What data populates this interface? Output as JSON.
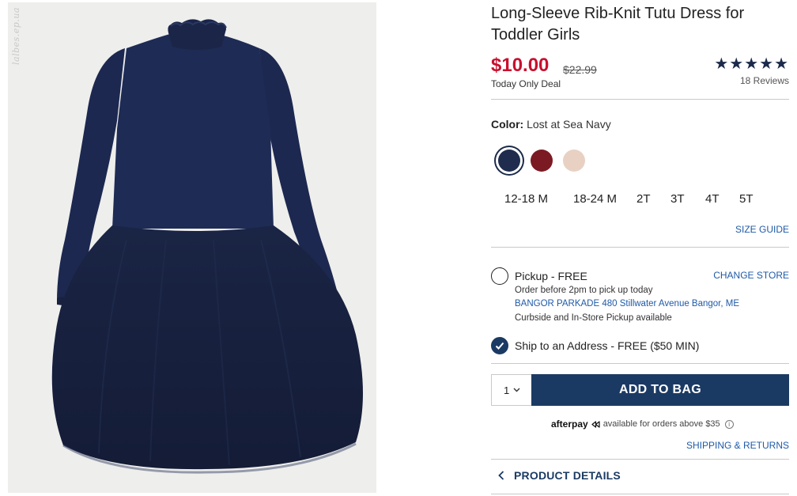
{
  "photo": {
    "watermark": "lalbes.ep.ua",
    "bg_color": "#eeeeec",
    "dress_color": "#1b2649"
  },
  "product": {
    "title": "Long-Sleeve Rib-Knit Tutu Dress for Toddler Girls",
    "price": "$10.00",
    "original_price": "$22.99",
    "deal_label": "Today Only Deal",
    "rating_stars": "★★★★★",
    "rating_value": 5,
    "reviews": "18 Reviews"
  },
  "color": {
    "label": "Color:",
    "selected_name": "Lost at Sea Navy",
    "swatches": [
      {
        "name": "navy-swatch",
        "hex": "#1f2c4d",
        "selected": true
      },
      {
        "name": "burgundy-swatch",
        "hex": "#7b1a23",
        "selected": false
      },
      {
        "name": "blush-swatch",
        "hex": "#e8d1c3",
        "selected": false
      }
    ]
  },
  "sizes": [
    "12-18 M",
    "18-24 M",
    "2T",
    "3T",
    "4T",
    "5T"
  ],
  "size_guide": "SIZE GUIDE",
  "fulfillment": {
    "pickup_label": "Pickup - FREE",
    "pickup_selected": false,
    "change_store": "CHANGE STORE",
    "order_before": "Order before 2pm to pick up today",
    "store": "BANGOR PARKADE 480 Stillwater Avenue  Bangor, ME",
    "curbside": "Curbside and In-Store Pickup available",
    "ship_label": "Ship to an Address - FREE ($50 MIN)",
    "ship_selected": true
  },
  "cart": {
    "qty": "1",
    "add_to_bag": "ADD TO BAG"
  },
  "afterpay": {
    "logo": "afterpay",
    "text": "available for orders above $35",
    "info": "i"
  },
  "shipping_returns": "SHIPPING & RETURNS",
  "product_details": "PRODUCT DETAILS"
}
